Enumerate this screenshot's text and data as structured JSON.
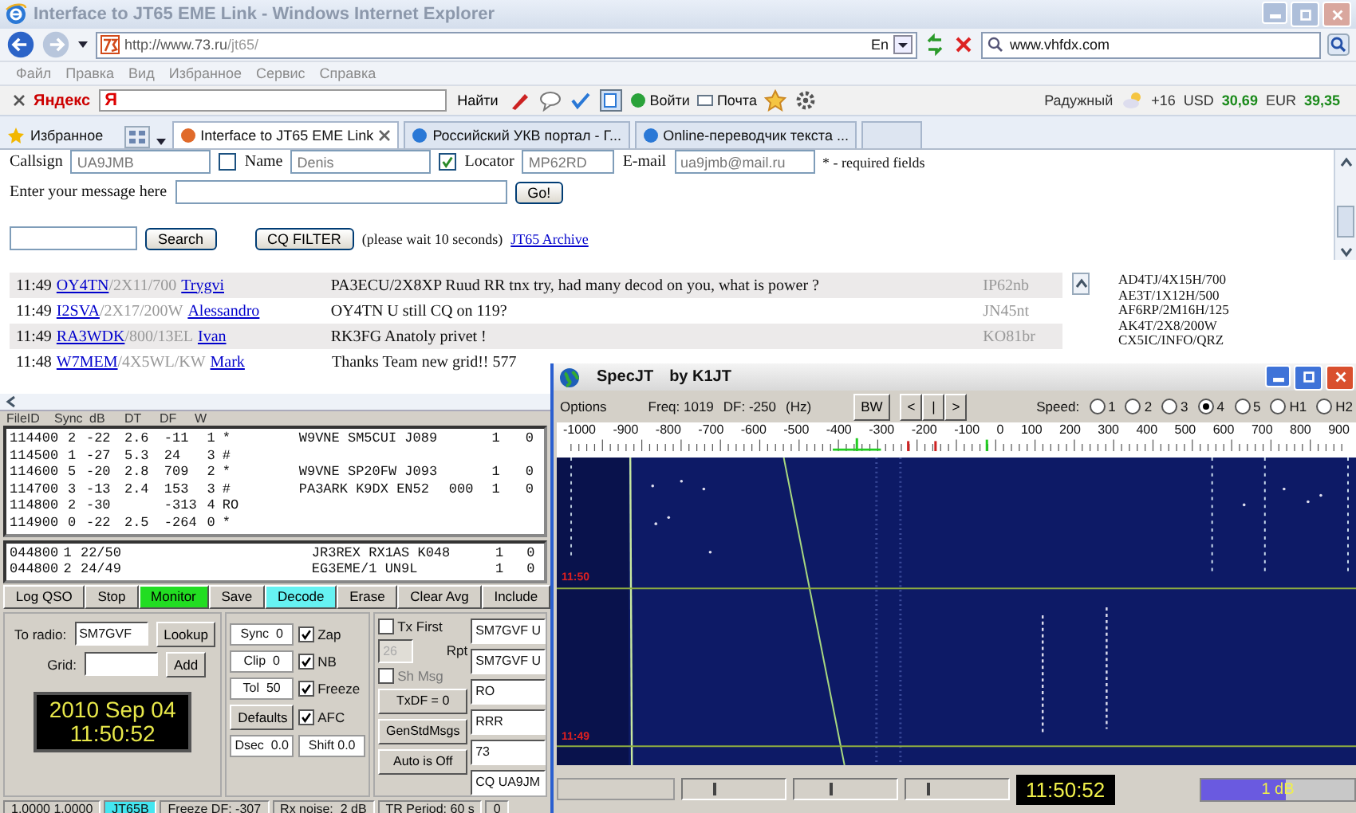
{
  "browser": {
    "title": "Interface to JT65 EME Link - Windows Internet Explorer",
    "address_host": "http://www.73.ru",
    "address_path": "/jt65/",
    "language": "En",
    "search": "www.vhfdx.com",
    "menu": [
      "Файл",
      "Правка",
      "Вид",
      "Избранное",
      "Сервис",
      "Справка"
    ],
    "yandex": {
      "logo": "Яндекс",
      "field": "Я",
      "find": "Найти",
      "login": "Войти",
      "mail": "Почта",
      "place": "Радужный",
      "temperature": "+16",
      "usd_label": "USD",
      "usd": "30,69",
      "eur_label": "EUR",
      "eur": "39,35"
    },
    "favorites": "Избранное",
    "tabs": [
      {
        "label": "Interface to JT65 EME Link",
        "selected": true
      },
      {
        "label": "Российский УКВ портал - Г...",
        "selected": false
      },
      {
        "label": "Online-переводчик текста ...",
        "selected": false
      }
    ]
  },
  "form": {
    "callsign_label": "Callsign",
    "callsign": "UA9JMB",
    "name_checked": false,
    "name_label": "Name",
    "name": "Denis",
    "locator_checked": true,
    "locator_label": "Locator",
    "locator": "MP62RD",
    "email_label": "E-mail",
    "email": "ua9jmb@mail.ru",
    "required_note": "* - required fields",
    "message_label": "Enter your message here",
    "go": "Go!",
    "search_button": "Search",
    "cq_filter": "CQ FILTER",
    "wait_note": "(please wait 10 seconds)",
    "archive_link": "JT65 Archive"
  },
  "chat": [
    {
      "time": "11:49",
      "call": "OY4TN",
      "info": "/2X11/700",
      "name": "Trygvi",
      "message": "PA3ECU/2X8XP Ruud RR tnx try, had many decod on you, what is power ?",
      "locator": "IP62nb"
    },
    {
      "time": "11:49",
      "call": "I2SVA",
      "info": "/2X17/200W",
      "name": "Alessandro",
      "message": "OY4TN U still CQ on 119?",
      "locator": "JN45nt"
    },
    {
      "time": "11:49",
      "call": "RA3WDK",
      "info": "/800/13EL",
      "name": "Ivan",
      "message": "RK3FG Anatoly privet !",
      "locator": "KO81br"
    },
    {
      "time": "11:48",
      "call": "W7MEM",
      "info": "/4X5WL/KW",
      "name": "Mark",
      "message": "Thanks Team new grid!! 577"
    }
  ],
  "callsign_list": [
    "AD4TJ/4X15H/700",
    "AE3T/1X12H/500",
    "AF6RP/2M16H/125",
    "AK4T/2X8/200W",
    "CX5IC/INFO/QRZ"
  ],
  "jt65": {
    "headers": [
      "FileID",
      "Sync",
      "dB",
      "DT",
      "DF",
      "W"
    ],
    "decodes": [
      {
        "file_id": "114400",
        "sync": "2",
        "db": "-22",
        "dt": "2.6",
        "df": "-11",
        "w": "1",
        "flag": "*",
        "message": "W9VNE SM5CUI J089",
        "col_9": "1",
        "col_10": "0"
      },
      {
        "file_id": "114500",
        "sync": "1",
        "db": "-27",
        "dt": "5.3",
        "df": "24",
        "w": "3",
        "flag": "#"
      },
      {
        "file_id": "114600",
        "sync": "5",
        "db": "-20",
        "dt": "2.8",
        "df": "709",
        "w": "2",
        "flag": "*",
        "message": "W9VNE SP20FW J093",
        "col_9": "1",
        "col_10": "0"
      },
      {
        "file_id": "114700",
        "sync": "3",
        "db": "-13",
        "dt": "2.4",
        "df": "153",
        "w": "3",
        "flag": "#",
        "message": "PA3ARK K9DX EN52",
        "col_8": "000",
        "col_9": "1",
        "col_10": "0"
      },
      {
        "file_id": "114800",
        "sync": "2",
        "db": "-30",
        "df": "-313",
        "w": "4",
        "flag": "RO"
      },
      {
        "file_id": "114900",
        "sync": "0",
        "db": "-22",
        "dt": "2.5",
        "df": "-264",
        "w": "0",
        "flag": "*"
      }
    ],
    "averages": [
      {
        "file_id": "044800",
        "n": "1",
        "ratio": "22/50",
        "message": "JR3REX RX1AS K048",
        "col_9": "1",
        "col_10": "0"
      },
      {
        "file_id": "044800",
        "n": "2",
        "ratio": "24/49",
        "message": "EG3EME/1 UN9L",
        "col_9": "1",
        "col_10": "0"
      }
    ],
    "buttons": [
      {
        "label": "Log QSO"
      },
      {
        "label": "Stop"
      },
      {
        "label": "Monitor",
        "color": "#22dd22"
      },
      {
        "label": "Save"
      },
      {
        "label": "Decode",
        "color": "#66f2f2"
      },
      {
        "label": "Erase"
      },
      {
        "label": "Clear Avg"
      },
      {
        "label": "Include"
      }
    ],
    "to_radio_label": "To radio:",
    "to_radio": "SM7GVF",
    "lookup": "Lookup",
    "grid_label": "Grid:",
    "add": "Add",
    "date": "2010 Sep 04",
    "clock": "11:50:52",
    "readouts": [
      "Sync  0",
      "Clip  0",
      "Tol  50"
    ],
    "defaults": "Defaults",
    "dsec": "Dsec  0.0",
    "shift": "Shift 0.0",
    "options": [
      {
        "label": "Zap",
        "checked": true
      },
      {
        "label": "NB",
        "checked": true
      },
      {
        "label": "Freeze",
        "checked": true
      },
      {
        "label": "AFC",
        "checked": true
      }
    ],
    "tx_first": {
      "label": "Tx First",
      "checked": false
    },
    "rpt": {
      "value": "26",
      "label": "Rpt",
      "disabled": true
    },
    "sh_msg": {
      "label": "Sh Msg",
      "checked": false,
      "disabled": true
    },
    "tx_buttons": [
      "TxDF = 0",
      "GenStdMsgs",
      "Auto is Off"
    ],
    "messages": [
      "SM7GVF U",
      "SM7GVF U",
      "RO",
      "RRR",
      "73",
      "CQ UA9JM"
    ],
    "status": [
      {
        "text": "1.0000 1.0000"
      },
      {
        "text": "JT65B",
        "color": "#44e6f0"
      },
      {
        "text": "Freeze DF: -307"
      },
      {
        "text": "Rx noise:  2 dB"
      },
      {
        "text": "TR Period: 60 s"
      },
      {
        "text": "0"
      }
    ]
  },
  "specjt": {
    "title": "SpecJT",
    "author": "by K1JT",
    "options": "Options",
    "freq": "Freq: 1019",
    "df": "DF: -250",
    "unit": "(Hz)",
    "bw": "BW",
    "nav": [
      "<",
      "|",
      ">"
    ],
    "speed_label": "Speed:",
    "speeds": [
      {
        "label": "1",
        "selected": false
      },
      {
        "label": "2",
        "selected": false
      },
      {
        "label": "3",
        "selected": false
      },
      {
        "label": "4",
        "selected": true
      },
      {
        "label": "5",
        "selected": false
      },
      {
        "label": "H1",
        "selected": false
      },
      {
        "label": "H2",
        "selected": false
      }
    ],
    "scale": [
      "-1000",
      "-900",
      "-800",
      "-700",
      "-600",
      "-500",
      "-400",
      "-300",
      "-200",
      "-100",
      "0",
      "100",
      "200",
      "300",
      "400",
      "500",
      "600",
      "700",
      "800",
      "900"
    ],
    "time_labels": [
      "11:50",
      "11:49"
    ],
    "sliders": [
      {
        "level": 0.3
      },
      {
        "level": 0.35
      },
      {
        "level": 0.2
      }
    ],
    "clock": "11:50:52",
    "gain": {
      "level": 0.55,
      "reading": "1 dB"
    }
  }
}
